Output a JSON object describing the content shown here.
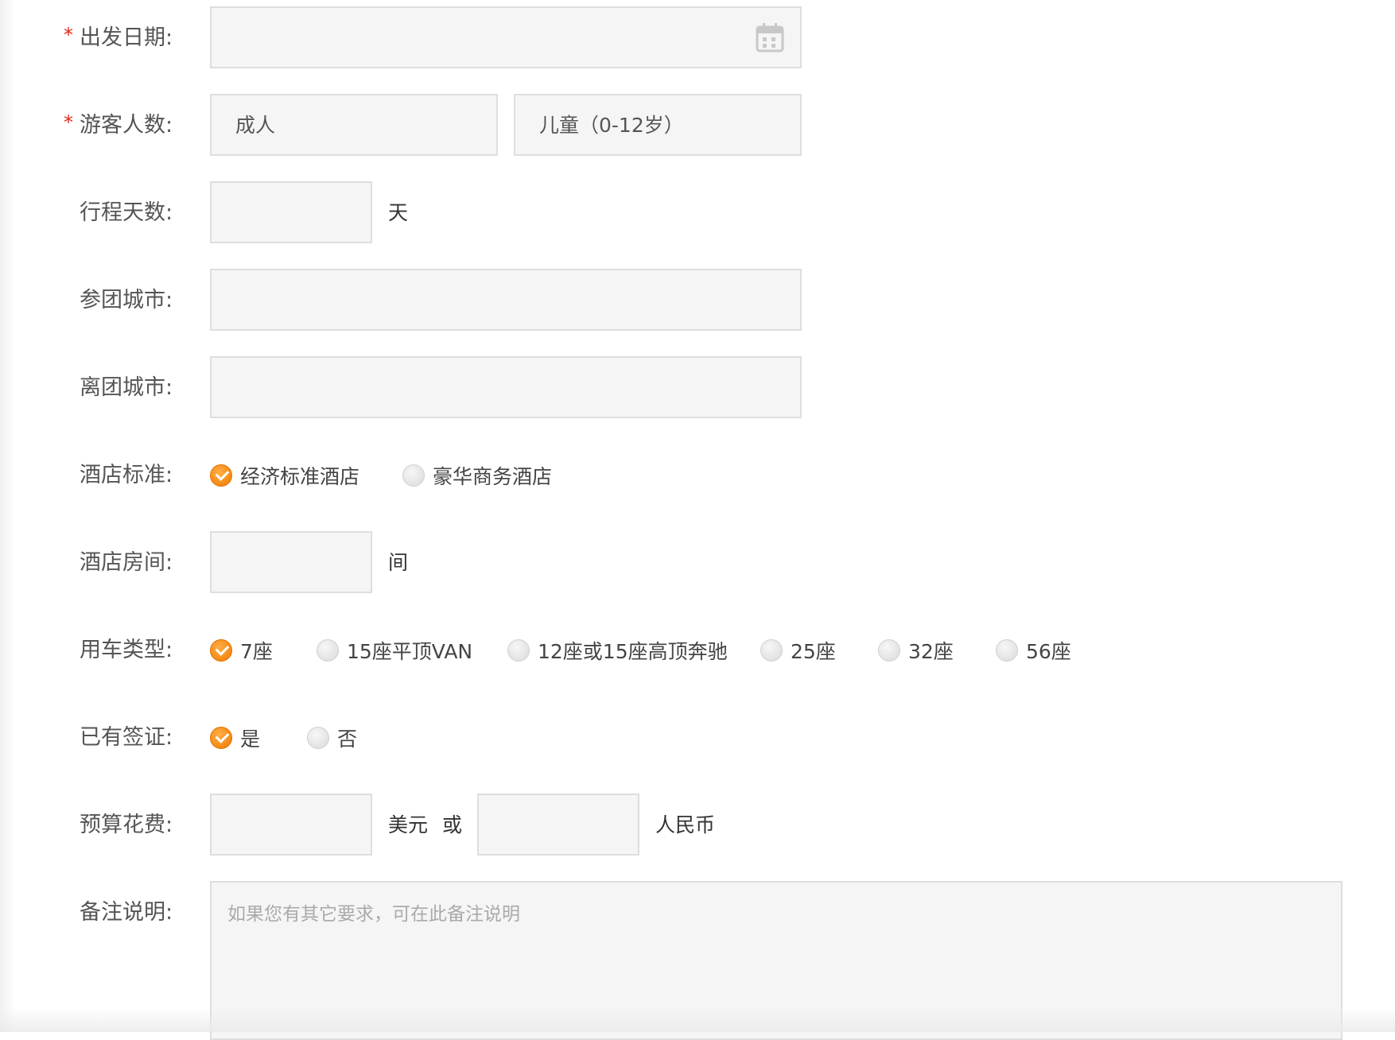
{
  "form": {
    "departure_date": {
      "label": "出发日期:",
      "required_mark": "*",
      "value": ""
    },
    "travelers": {
      "label": "游客人数:",
      "required_mark": "*",
      "adult_placeholder": "成人",
      "child_placeholder": "儿童（0-12岁）"
    },
    "trip_days": {
      "label": "行程天数:",
      "value": "",
      "unit": "天"
    },
    "join_city": {
      "label": "参团城市:",
      "value": ""
    },
    "leave_city": {
      "label": "离团城市:",
      "value": ""
    },
    "hotel_standard": {
      "label": "酒店标准:",
      "options": [
        {
          "label": "经济标准酒店",
          "checked": true
        },
        {
          "label": "豪华商务酒店",
          "checked": false
        }
      ]
    },
    "hotel_rooms": {
      "label": "酒店房间:",
      "value": "",
      "unit": "间"
    },
    "vehicle_type": {
      "label": "用车类型:",
      "options": [
        {
          "label": "7座",
          "checked": true
        },
        {
          "label": "15座平顶VAN",
          "checked": false
        },
        {
          "label": "12座或15座高顶奔驰",
          "checked": false
        },
        {
          "label": "25座",
          "checked": false
        },
        {
          "label": "32座",
          "checked": false
        },
        {
          "label": "56座",
          "checked": false
        }
      ]
    },
    "visa": {
      "label": "已有签证:",
      "options": [
        {
          "label": "是",
          "checked": true
        },
        {
          "label": "否",
          "checked": false
        }
      ]
    },
    "budget": {
      "label": "预算花费:",
      "usd_unit": "美元",
      "or_text": "或",
      "rmb_unit": "人民币"
    },
    "remarks": {
      "label": "备注说明:",
      "placeholder": "如果您有其它要求，可在此备注说明"
    }
  },
  "colors": {
    "accent": "#f07a00",
    "required": "#e0261b",
    "field_bg": "#f5f5f5",
    "field_border": "#dedede"
  }
}
